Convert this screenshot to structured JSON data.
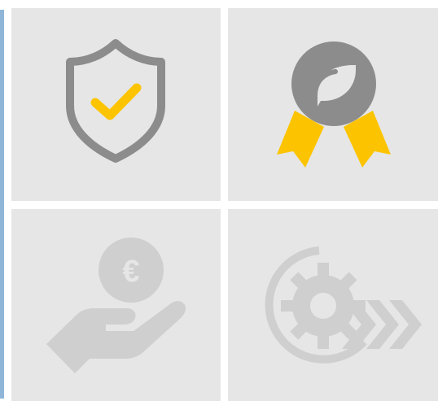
{
  "tiles": [
    {
      "icon": "shield-check-icon",
      "state": "active"
    },
    {
      "icon": "eco-award-badge-icon",
      "state": "active"
    },
    {
      "icon": "euro-hand-icon",
      "state": "muted"
    },
    {
      "icon": "gear-fast-forward-icon",
      "state": "muted"
    }
  ],
  "colors": {
    "tile_background": "#e6e6e6",
    "icon_dark": "#8c8c8c",
    "icon_muted": "#cfcfcf",
    "accent_yellow": "#fcc400",
    "left_accent_bar": "#8fb6d8"
  },
  "currency_symbol": "€"
}
